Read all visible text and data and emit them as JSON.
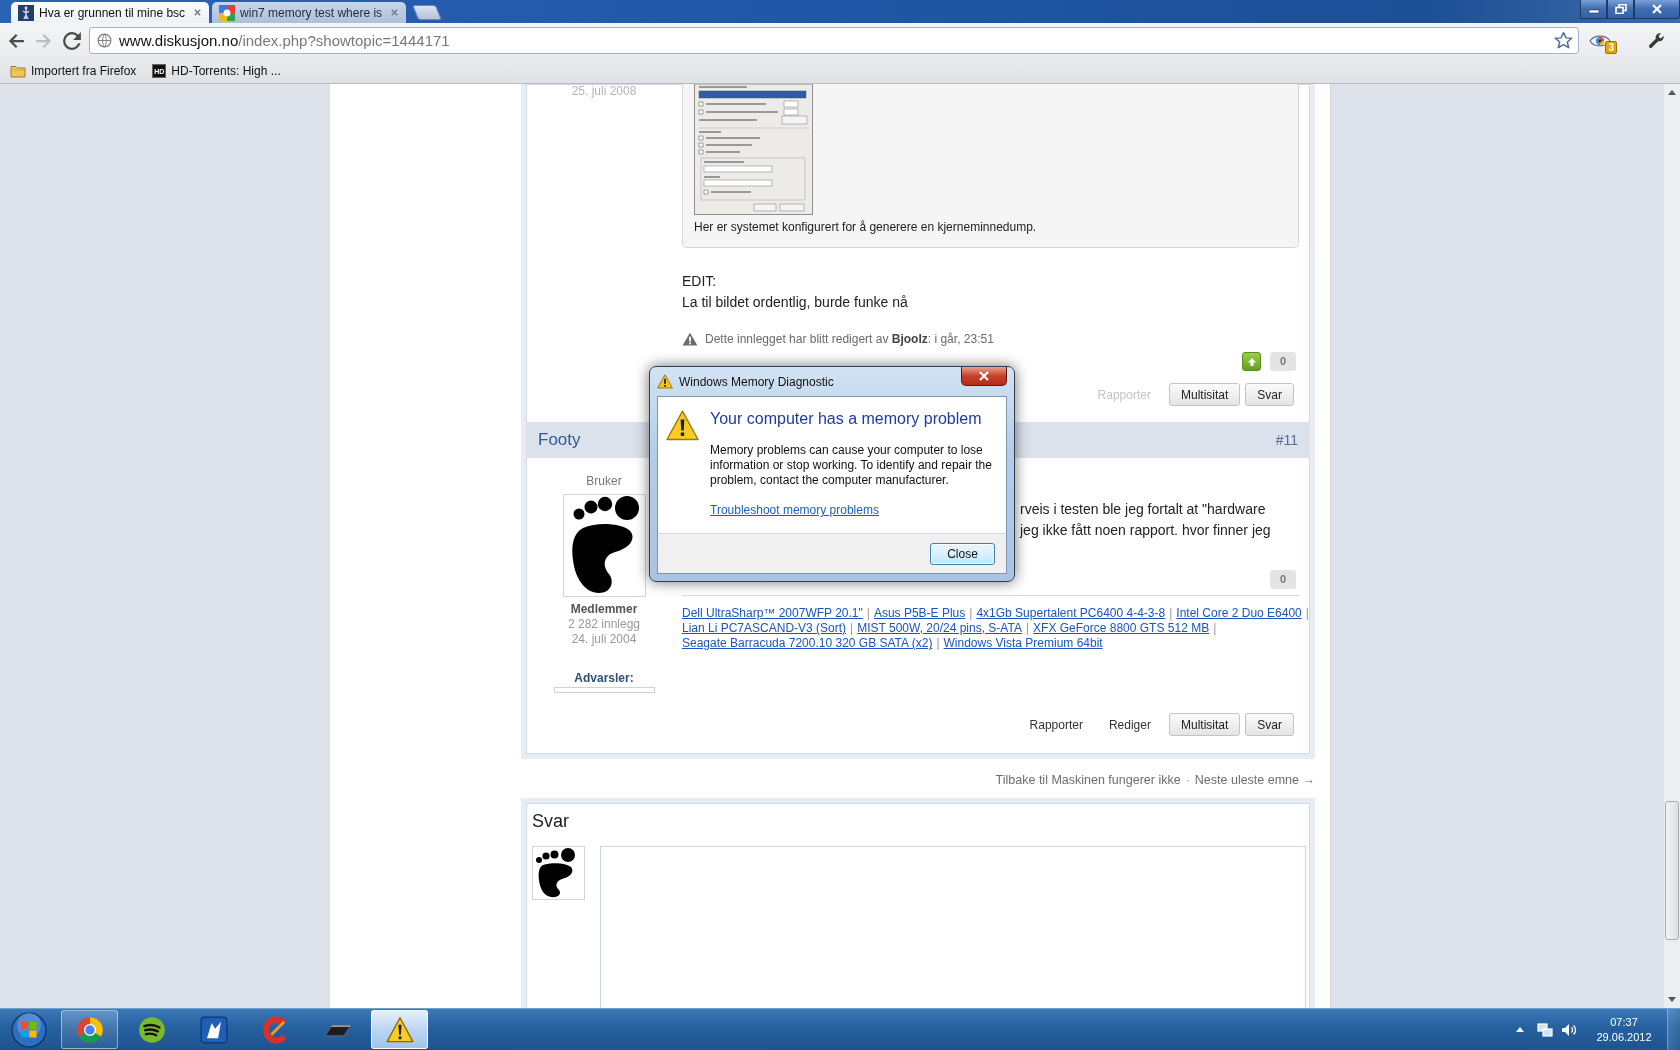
{
  "browser": {
    "tabs": [
      {
        "title": "Hva er grunnen til mine bsc",
        "selected": true,
        "kind": "forum"
      },
      {
        "title": "win7 memory test where is",
        "selected": false,
        "kind": "search"
      }
    ],
    "navigation": {
      "back_enabled": true,
      "forward_enabled": false
    },
    "address": {
      "host": "www.diskusjon.no",
      "path": "/index.php?showtopic=1444171"
    },
    "extension_badge": "3",
    "bookmarks": [
      {
        "label": "Importert fra Firefox",
        "kind": "folder"
      },
      {
        "label": "HD-Torrents: High ...",
        "kind": "site",
        "favicon_text": "HD"
      }
    ]
  },
  "previous_post": {
    "date": "25. juli 2008",
    "quote_caption": "Her er systemet konfigurert for å generere en kjerneminnedump.",
    "body_lines": [
      "EDIT:",
      "La til bildet ordentlig, burde funke nå"
    ],
    "edit_note": "Dette innlegget har blitt redigert av **Bjoolz**: i går, 23:51",
    "reputation": {
      "vote_button": true,
      "count": "0"
    },
    "actions": [
      {
        "label": "Rapporter",
        "kind": "link",
        "disabled": true
      },
      {
        "label": "Multisitat",
        "kind": "button",
        "disabled": false
      },
      {
        "label": "Svar",
        "kind": "button",
        "disabled": false
      }
    ]
  },
  "post": {
    "author": "Footy",
    "number": "#11",
    "user_title": "Bruker",
    "group": "Medlemmer",
    "post_count": "2 282 innlegg",
    "joined": "24. juli 2004",
    "warnings": {
      "label": "Advarsler:",
      "level": 0
    },
    "body_lines": [
      "rveis i testen ble jeg fortalt at \"hardware",
      "jeg ikke fått noen rapport. hvor finner jeg"
    ],
    "reputation": {
      "vote_button": false,
      "count": "0"
    },
    "signature": [
      {
        "kind": "link",
        "text": "Dell UltraSharp™ 2007WFP 20.1\""
      },
      {
        "kind": "separator",
        "text": "|"
      },
      {
        "kind": "link",
        "text": "Asus P5B-E Plus"
      },
      {
        "kind": "separator",
        "text": "|"
      },
      {
        "kind": "link",
        "text": "4x1Gb Supertalent PC6400 4-4-3-8"
      },
      {
        "kind": "separator",
        "text": "|"
      },
      {
        "kind": "link",
        "text": "Intel Core 2 Duo E6400"
      },
      {
        "kind": "separator",
        "text": "|"
      },
      {
        "kind": "link",
        "text": "Lian Li PC7ASCAND-V3 (Sort)"
      },
      {
        "kind": "separator",
        "text": "|"
      },
      {
        "kind": "link",
        "text": "MIST 500W, 20/24 pins, S-ATA"
      },
      {
        "kind": "separator",
        "text": "|"
      },
      {
        "kind": "link",
        "text": "XFX GeForce 8800 GTS 512 MB"
      },
      {
        "kind": "separator",
        "text": "|"
      },
      {
        "kind": "link",
        "text": "Seagate Barracuda 7200.10 320 GB SATA (x2)"
      },
      {
        "kind": "separator",
        "text": "|"
      },
      {
        "kind": "link",
        "text": "Windows Vista Premium 64bit"
      }
    ],
    "actions": [
      {
        "label": "Rapporter",
        "kind": "link",
        "disabled": false
      },
      {
        "label": "Rediger",
        "kind": "link",
        "disabled": false
      },
      {
        "label": "Multisitat",
        "kind": "button",
        "disabled": false
      },
      {
        "label": "Svar",
        "kind": "button",
        "disabled": false
      }
    ]
  },
  "topic_nav": {
    "back": "Tilbake til Maskinen fungerer ikke",
    "separator": "·",
    "next": "Neste uleste emne →"
  },
  "reply": {
    "title": "Svar"
  },
  "dialog": {
    "title": "Windows Memory Diagnostic",
    "heading": "Your computer has a memory problem",
    "message": "Memory problems can cause your computer to lose information or stop working. To identify and repair the problem, contact the computer manufacturer.",
    "link": "Troubleshoot memory problems",
    "button": "Close"
  },
  "taskbar": {
    "buttons": [
      {
        "kind": "browser",
        "running": true,
        "selected": false
      },
      {
        "kind": "music",
        "running": false,
        "selected": false
      },
      {
        "kind": "tile",
        "running": false,
        "selected": false
      },
      {
        "kind": "cleaner",
        "running": false,
        "selected": false
      },
      {
        "kind": "console",
        "running": false,
        "selected": false
      },
      {
        "kind": "warning",
        "running": true,
        "selected": true
      }
    ],
    "clock": {
      "time": "07:37",
      "date": "29.06.2012"
    }
  }
}
